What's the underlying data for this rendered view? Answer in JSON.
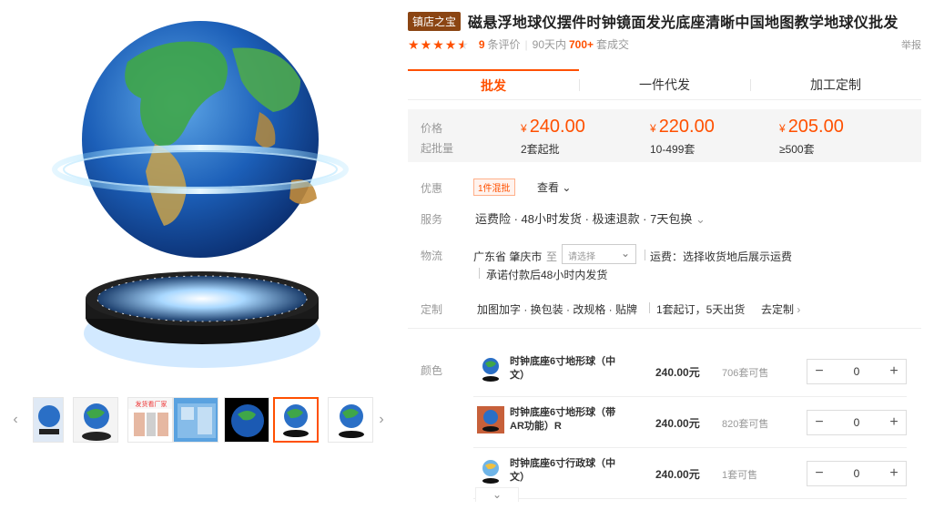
{
  "gallery": {
    "main_alt": "磁悬浮地球仪主图",
    "thumb_labels": [
      "",
      "",
      "发货看厂家",
      "",
      "",
      "",
      ""
    ]
  },
  "product": {
    "shop_badge": "镇店之宝",
    "title": "磁悬浮地球仪摆件时钟镜面发光底座清晰中国地图教学地球仪批发",
    "review_count": "9",
    "review_label": "条评价",
    "sales_prefix": "90天内",
    "sales_count": "700+",
    "sales_suffix": "套成交",
    "report": "举报"
  },
  "tabs": [
    "批发",
    "一件代发",
    "加工定制"
  ],
  "price": {
    "price_label": "价格",
    "moq_label": "起批量",
    "currency": "¥",
    "tiers": [
      {
        "price": "240.00",
        "qty": "2套起批"
      },
      {
        "price": "220.00",
        "qty": "10-499套"
      },
      {
        "price": "205.00",
        "qty": "≥500套"
      }
    ]
  },
  "promo": {
    "label": "优惠",
    "tag": "1件混批",
    "view": "查看"
  },
  "service": {
    "label": "服务",
    "text": "运费险 · 48小时发货 · 极速退款 · 7天包换"
  },
  "logistics": {
    "label": "物流",
    "origin": "广东省 肇庆市",
    "to": "至",
    "select_placeholder": "请选择",
    "fee": "运费：选择收货地后展示运费",
    "promise": "承诺付款后48小时内发货"
  },
  "custom": {
    "label": "定制",
    "options": "加图加字 · 换包装 · 改规格 · 贴牌",
    "moq": "1套起订，5天出货",
    "link": "去定制"
  },
  "color": {
    "label": "颜色",
    "skus": [
      {
        "name": "时钟底座6寸地形球（中文）",
        "price": "240.00元",
        "stock": "706套可售",
        "qty": "0"
      },
      {
        "name": "时钟底座6寸地形球（带AR功能）R",
        "price": "240.00元",
        "stock": "820套可售",
        "qty": "0"
      },
      {
        "name": "时钟底座6寸行政球（中文）",
        "price": "240.00元",
        "stock": "1套可售",
        "qty": "0"
      }
    ]
  },
  "colors": {
    "accent": "#ff5000",
    "badge": "#8b4513",
    "price_bg": "#f5f5f5"
  }
}
